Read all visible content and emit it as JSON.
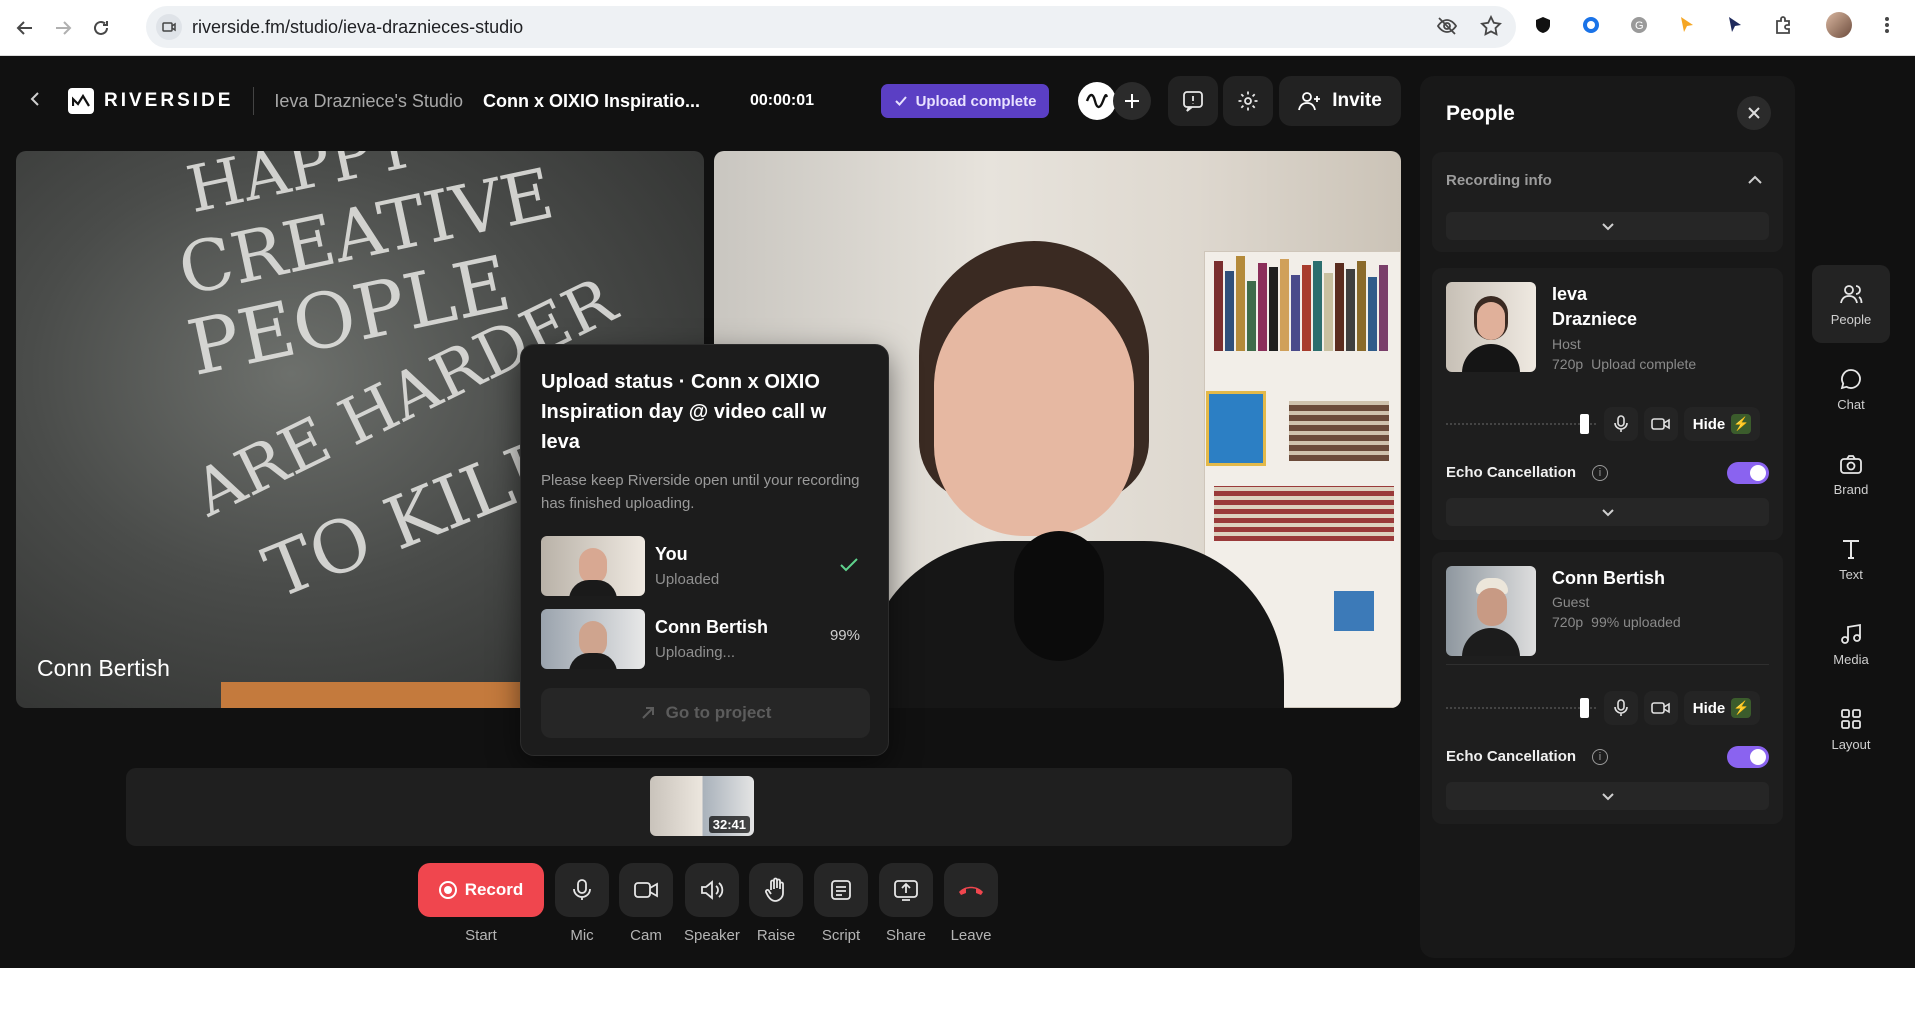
{
  "browser": {
    "url": "riverside.fm/studio/ieva-draznieces-studio"
  },
  "app": {
    "brand": "RIVERSIDE",
    "studio_name": "Ieva Drazniece's Studio",
    "project_name": "Conn x OIXIO Inspiratio...",
    "timer": "00:00:01",
    "upload_badge": "Upload complete",
    "invite_label": "Invite"
  },
  "tiles": [
    {
      "name": "Conn Bertish"
    },
    {
      "name": ""
    }
  ],
  "chalk_text": [
    "HAPPY",
    "CREATIVE",
    "PEOPLE",
    "ARE HARDER",
    "TO KILL!"
  ],
  "upload_popover": {
    "title": "Upload status · Conn x OIXIO Inspiration day @ video call w Ieva",
    "description": "Please keep Riverside open until your recording has finished uploading.",
    "rows": [
      {
        "name": "You",
        "status": "Uploaded",
        "right": ""
      },
      {
        "name": "Conn Bertish",
        "status": "Uploading...",
        "right": "99%"
      }
    ],
    "goto_label": "Go to project"
  },
  "strip": {
    "duration": "32:41"
  },
  "controls": {
    "record_label": "Record",
    "start_label": "Start",
    "mic": "Mic",
    "cam": "Cam",
    "speaker": "Speaker",
    "raise": "Raise",
    "script": "Script",
    "share": "Share",
    "leave": "Leave"
  },
  "people_panel": {
    "title": "People",
    "recording_info": "Recording info",
    "participants": [
      {
        "name_line1": "Ieva",
        "name_line2": "Drazniece",
        "role": "Host",
        "resolution": "720p",
        "upload": "Upload complete",
        "hide": "Hide",
        "echo": "Echo Cancellation",
        "echo_on": true
      },
      {
        "name_line1": "Conn Bertish",
        "name_line2": "",
        "role": "Guest",
        "resolution": "720p",
        "upload": "99% uploaded",
        "hide": "Hide",
        "echo": "Echo Cancellation",
        "echo_on": true
      }
    ]
  },
  "rail": [
    {
      "label": "People",
      "icon": "people-icon",
      "active": true
    },
    {
      "label": "Chat",
      "icon": "chat-icon",
      "active": false
    },
    {
      "label": "Brand",
      "icon": "brand-icon",
      "active": false
    },
    {
      "label": "Text",
      "icon": "text-icon",
      "active": false
    },
    {
      "label": "Media",
      "icon": "media-icon",
      "active": false
    },
    {
      "label": "Layout",
      "icon": "layout-icon",
      "active": false
    }
  ],
  "colors": {
    "accent": "#8a63f0",
    "record": "#f0464e",
    "upload_badge": "#5b3fc4",
    "background": "#111111"
  }
}
